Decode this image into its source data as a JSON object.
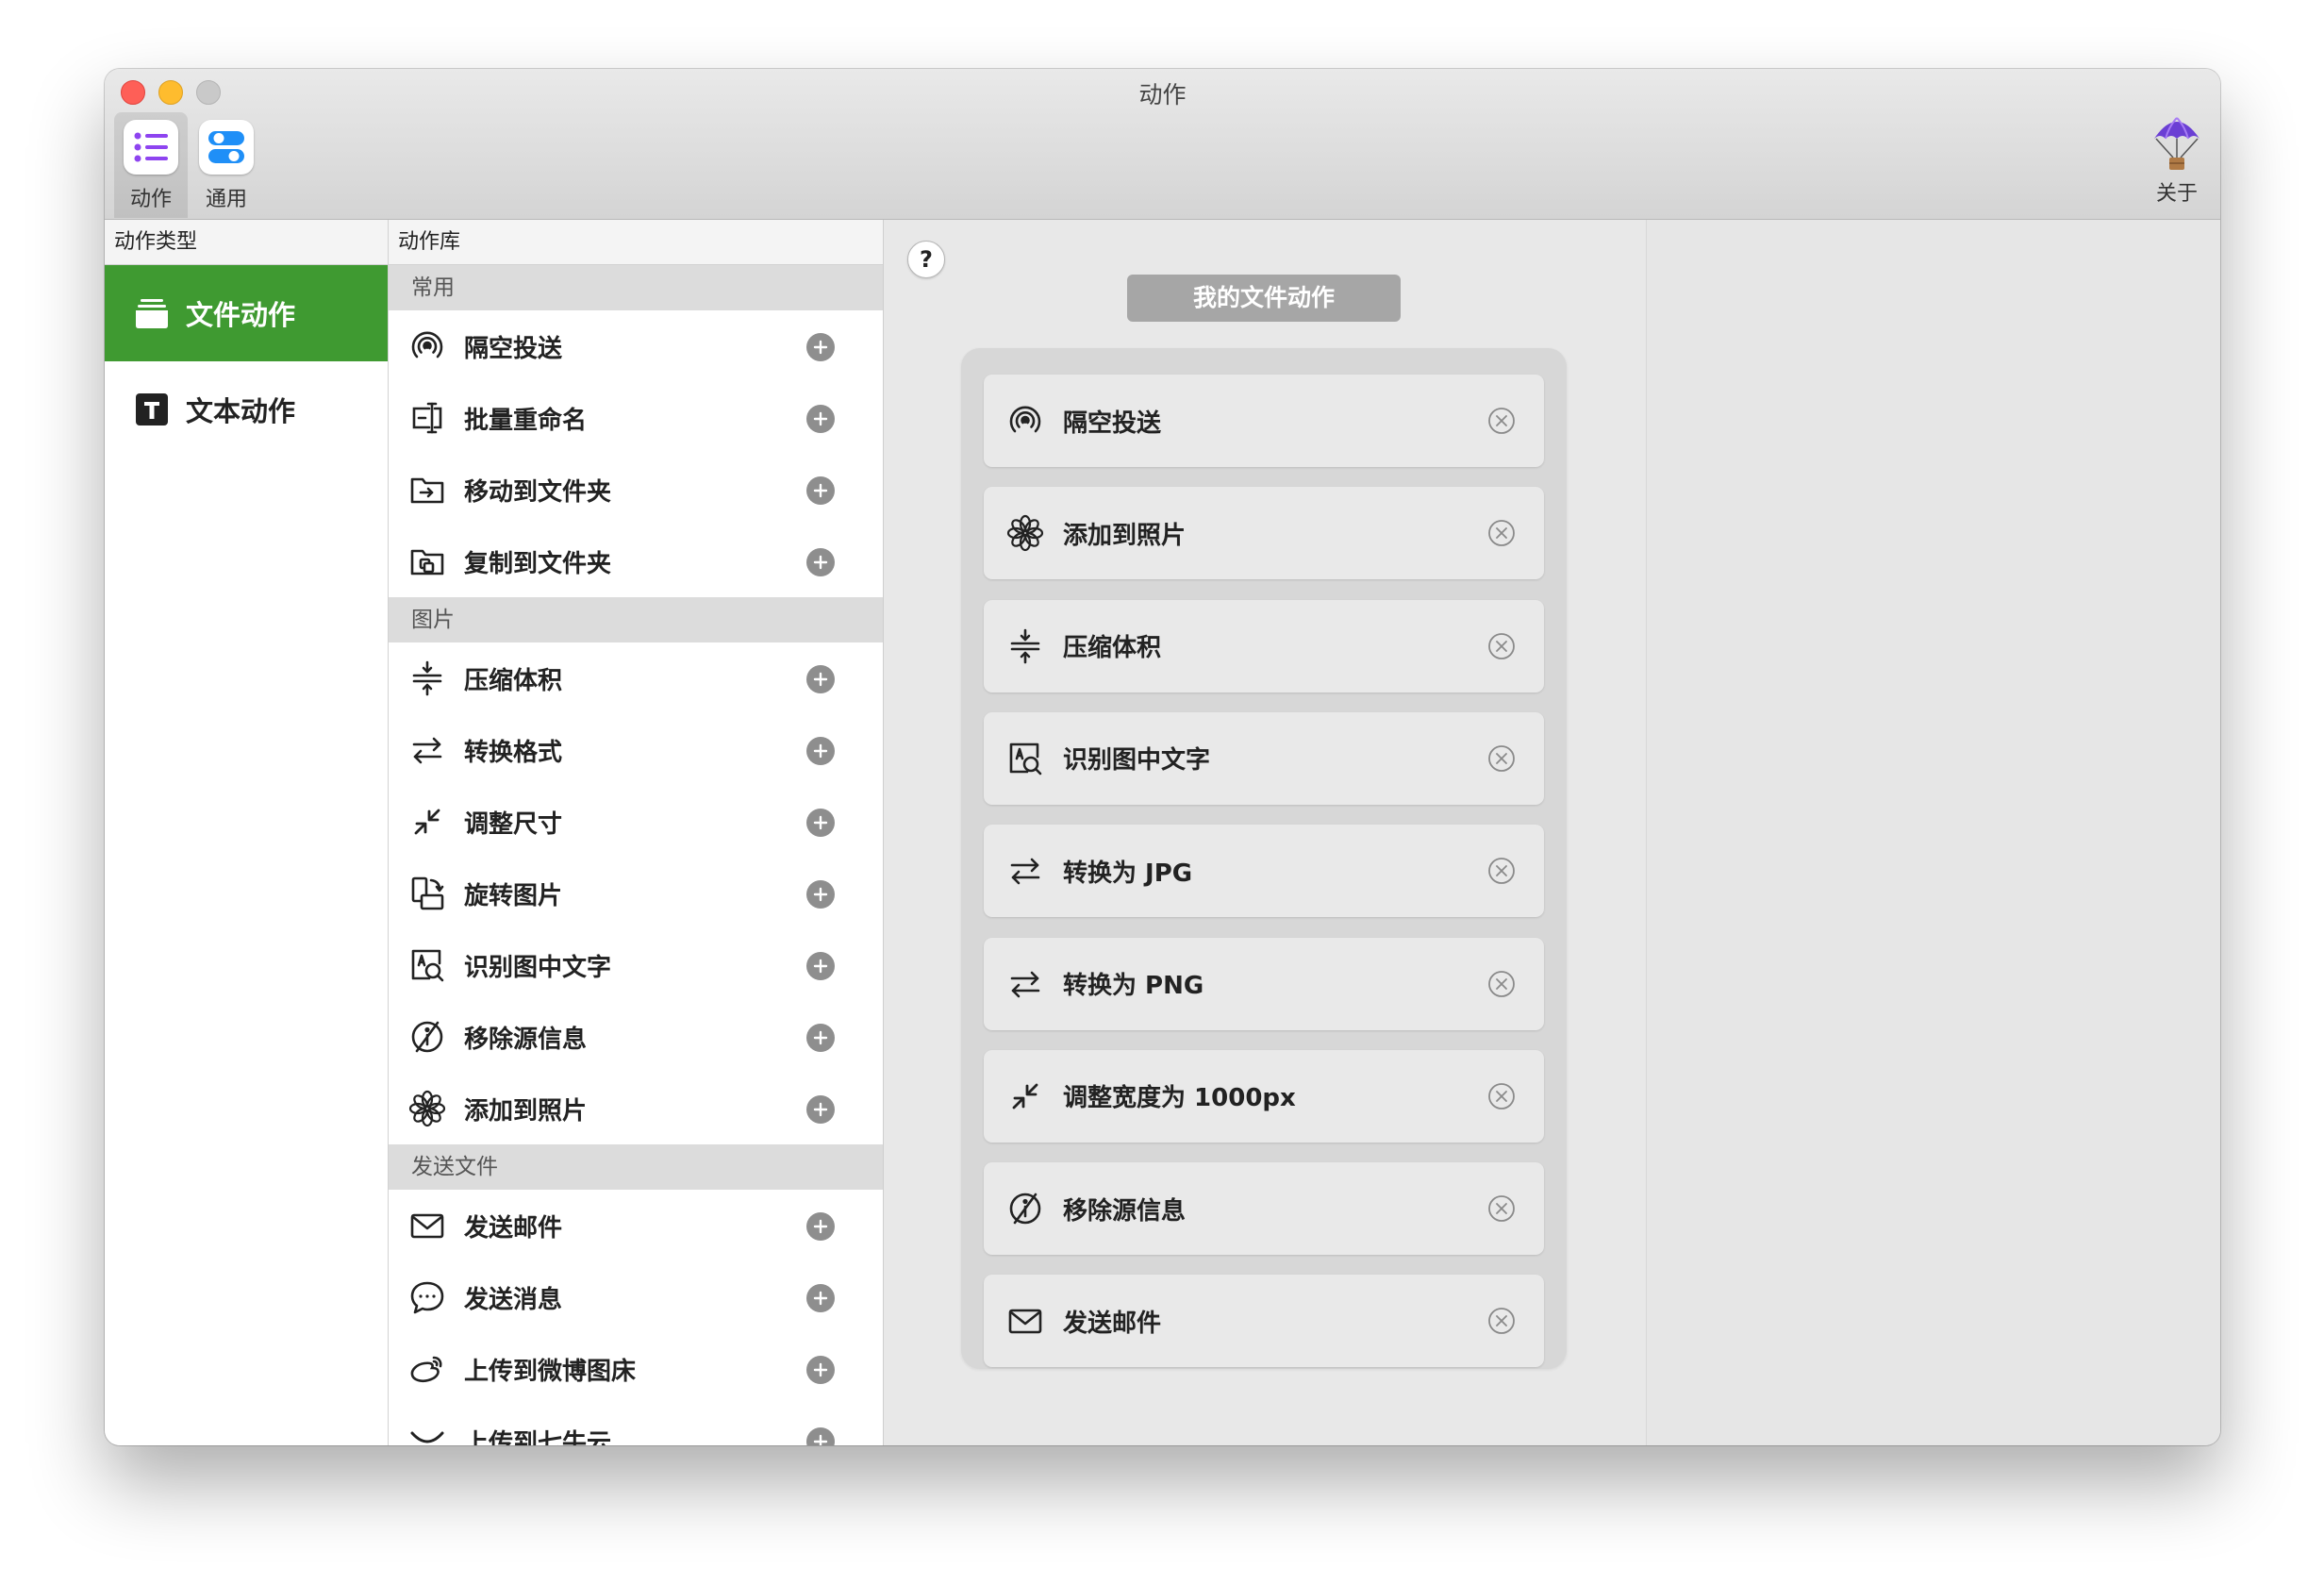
{
  "window": {
    "title": "动作"
  },
  "toolbar": {
    "items": [
      {
        "label": "动作",
        "icon": "list-icon",
        "active": true
      },
      {
        "label": "通用",
        "icon": "toggles-icon",
        "active": false
      }
    ],
    "about_label": "关于",
    "about_icon": "parachute-icon"
  },
  "types": {
    "header": "动作类型",
    "items": [
      {
        "label": "文件动作",
        "icon": "tray-icon",
        "selected": true
      },
      {
        "label": "文本动作",
        "icon": "text-box-icon",
        "selected": false
      }
    ]
  },
  "library": {
    "header": "动作库",
    "sections": [
      {
        "title": "常用",
        "items": [
          {
            "label": "隔空投送",
            "icon": "airdrop-icon"
          },
          {
            "label": "批量重命名",
            "icon": "rename-icon"
          },
          {
            "label": "移动到文件夹",
            "icon": "folder-move-icon"
          },
          {
            "label": "复制到文件夹",
            "icon": "folder-copy-icon"
          }
        ]
      },
      {
        "title": "图片",
        "items": [
          {
            "label": "压缩体积",
            "icon": "compress-icon"
          },
          {
            "label": "转换格式",
            "icon": "swap-arrows-icon"
          },
          {
            "label": "调整尺寸",
            "icon": "shrink-arrows-icon"
          },
          {
            "label": "旋转图片",
            "icon": "rotate-icon"
          },
          {
            "label": "识别图中文字",
            "icon": "text-scan-icon"
          },
          {
            "label": "移除源信息",
            "icon": "info-remove-icon"
          },
          {
            "label": "添加到照片",
            "icon": "photos-flower-icon"
          }
        ]
      },
      {
        "title": "发送文件",
        "items": [
          {
            "label": "发送邮件",
            "icon": "mail-icon"
          },
          {
            "label": "发送消息",
            "icon": "message-icon"
          },
          {
            "label": "上传到微博图床",
            "icon": "weibo-icon"
          },
          {
            "label": "上传到七牛云",
            "icon": "cloud-upload-icon"
          }
        ]
      }
    ]
  },
  "my_actions": {
    "title": "我的文件动作",
    "help": "?",
    "items": [
      {
        "label": "隔空投送",
        "icon": "airdrop-icon"
      },
      {
        "label": "添加到照片",
        "icon": "photos-flower-icon"
      },
      {
        "label": "压缩体积",
        "icon": "compress-icon"
      },
      {
        "label": "识别图中文字",
        "icon": "text-scan-icon"
      },
      {
        "label": "转换为 JPG",
        "icon": "swap-arrows-icon"
      },
      {
        "label": "转换为 PNG",
        "icon": "swap-arrows-icon"
      },
      {
        "label": "调整宽度为 1000px",
        "icon": "shrink-arrows-icon"
      },
      {
        "label": "移除源信息",
        "icon": "info-remove-icon"
      },
      {
        "label": "发送邮件",
        "icon": "mail-icon"
      }
    ]
  },
  "colors": {
    "selected": "#3f9a31",
    "toolbar_accent": "#8e44f0",
    "toggle_accent": "#1f8ff7"
  }
}
